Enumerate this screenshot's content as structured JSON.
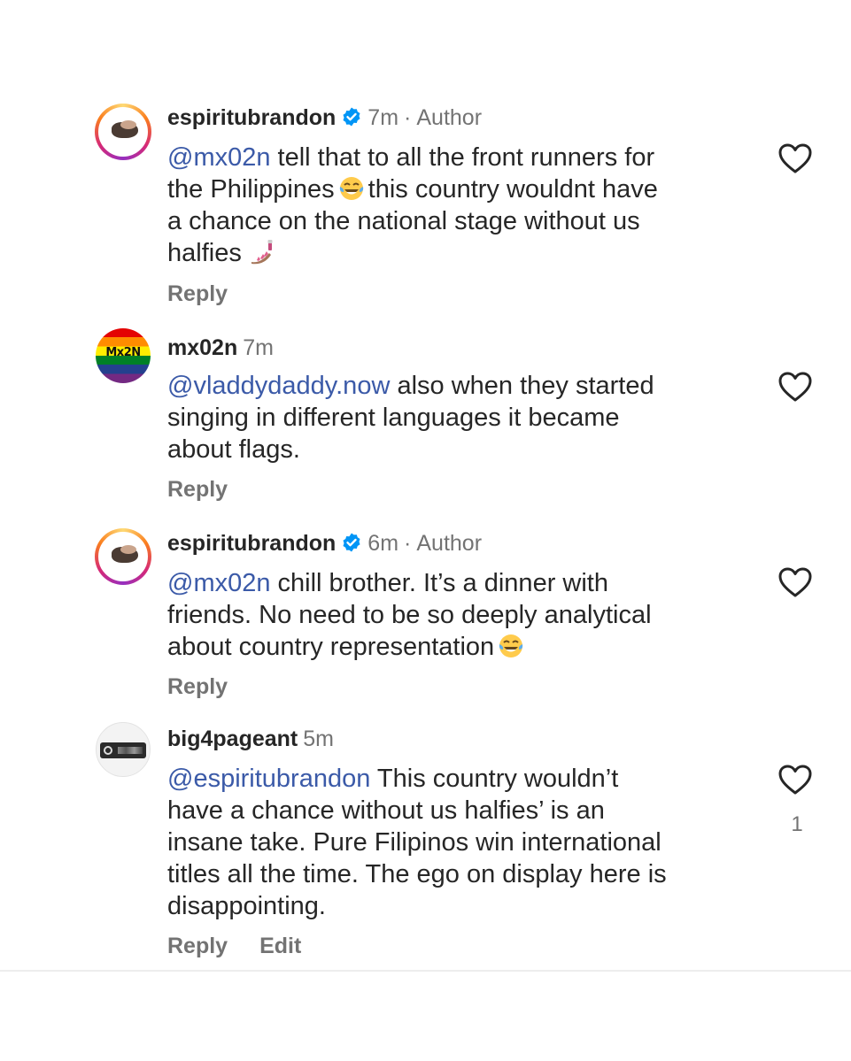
{
  "comments": [
    {
      "username": "espiritubrandon",
      "time": "7m",
      "separator": "·",
      "role": "Author",
      "mention": "@mx02n",
      "lines": [
        "tell that to all the front runners for",
        "the Philippines",
        "this country wouldnt have",
        "a chance on the national stage without us",
        "halfies"
      ],
      "reply": "Reply"
    },
    {
      "username": "mx02n",
      "avatar_text": "Mx2N",
      "time": "7m",
      "mention": "@vladdydaddy.now",
      "lines": [
        "also when they started",
        "singing in different languages it became",
        "about flags."
      ],
      "reply": "Reply"
    },
    {
      "username": "espiritubrandon",
      "time": "6m",
      "separator": "·",
      "role": "Author",
      "mention": "@mx02n",
      "lines": [
        "chill brother. It’s a dinner with",
        "friends. No need to be so deeply analytical",
        "about country representation"
      ],
      "reply": "Reply"
    },
    {
      "username": "big4pageant",
      "time": "5m",
      "mention": "@espiritubrandon",
      "lines": [
        "This country wouldn’t",
        "have a chance without us halfies’ is an",
        "insane take. Pure Filipinos win international",
        "titles all the time. The ego on display here is",
        "disappointing."
      ],
      "reply": "Reply",
      "edit": "Edit",
      "like_count": "1"
    }
  ],
  "icons": {
    "verified": "verified-badge-icon",
    "heart": "heart-outline-icon",
    "laughing": "face-with-tears-of-joy-emoji",
    "nails": "nail-polish-emoji"
  },
  "colors": {
    "mention": "#3b5aa8",
    "verified": "#0095f6",
    "secondary_text": "#737373"
  }
}
